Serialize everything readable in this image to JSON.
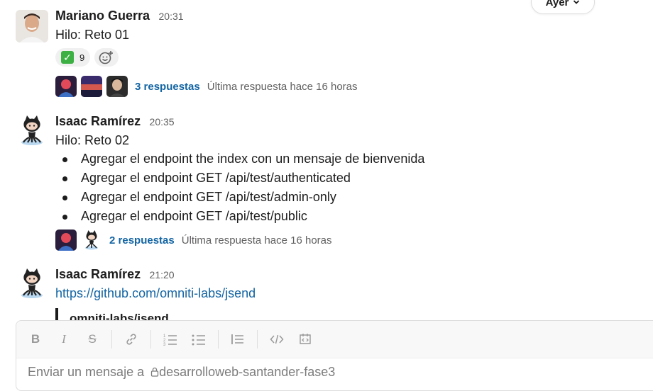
{
  "day_divider": {
    "label": "Ayer"
  },
  "messages": [
    {
      "author": "Mariano Guerra",
      "time": "20:31",
      "text": "Hilo: Reto 01",
      "reaction": {
        "emoji": "white-check-mark",
        "count": "9"
      },
      "thread": {
        "replies": "3 respuestas",
        "last_reply": "Última respuesta hace 16 horas"
      }
    },
    {
      "author": "Isaac Ramírez",
      "time": "20:35",
      "text": "Hilo: Reto 02",
      "bullets": [
        "Agregar el endpoint the index con un mensaje de bienvenida",
        "Agregar el endpoint GET /api/test/authenticated",
        "Agregar el endpoint GET /api/test/admin-only",
        "Agregar el endpoint GET /api/test/public"
      ],
      "thread": {
        "replies": "2 respuestas",
        "last_reply": "Última respuesta hace 16 horas"
      }
    },
    {
      "author": "Isaac Ramírez",
      "time": "21:20",
      "link": "https://github.com/omniti-labs/jsend",
      "unfurl_title": "omniti-labs/jsend"
    }
  ],
  "composer": {
    "placeholder_prefix": "Enviar un mensaje a",
    "channel": "desarrolloweb-santander-fase3",
    "toolbar": [
      "bold-icon",
      "italic-icon",
      "strikethrough-icon",
      "link-icon",
      "ordered-list-icon",
      "bulleted-list-icon",
      "blockquote-icon",
      "code-icon",
      "code-block-icon"
    ]
  },
  "colors": {
    "link": "#1264a3",
    "text": "#1d1c1d",
    "muted": "#616061"
  }
}
